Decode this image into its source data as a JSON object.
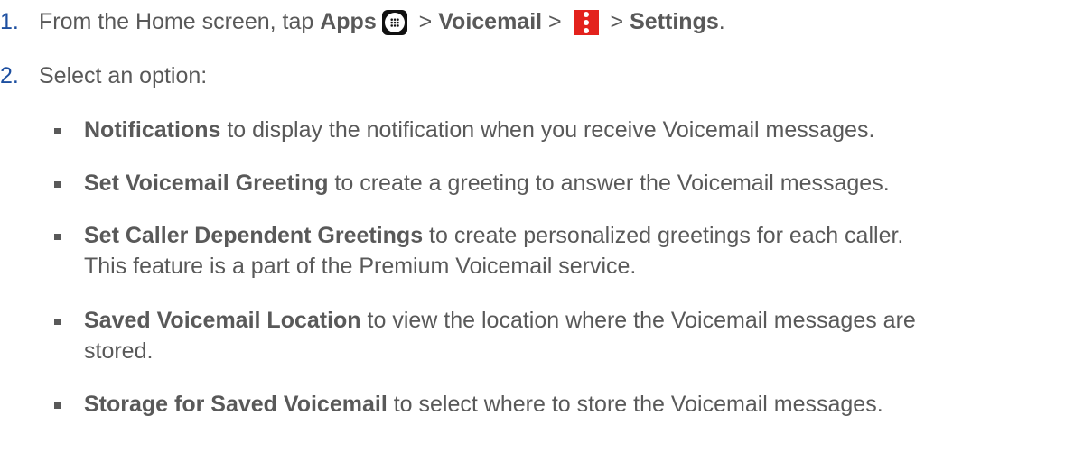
{
  "steps": [
    {
      "num": "1.",
      "pre": "From the Home screen, tap ",
      "apps": "Apps",
      "icon1": "apps-grid-icon",
      "sep1": " > ",
      "voicemail": "Voicemail",
      "sep2": " > ",
      "icon2": "menu-icon",
      "sep3": " > ",
      "settings": "Settings",
      "end": "."
    },
    {
      "num": "2.",
      "text": "Select an option:"
    }
  ],
  "options": [
    {
      "title": "Notifications",
      "desc": " to display the notification when you receive Voicemail messages."
    },
    {
      "title": "Set Voicemail Greeting",
      "desc": " to create a greeting to answer the Voicemail messages."
    },
    {
      "title": "Set Caller Dependent Greetings",
      "desc": " to create personalized greetings for each caller.",
      "desc2": "This feature is a part of the Premium Voicemail service."
    },
    {
      "title": "Saved Voicemail Location",
      "desc": " to view the location where the Voicemail messages are",
      "desc2": "stored."
    },
    {
      "title": "Storage for Saved Voicemail",
      "desc": " to select where to store the Voicemail messages."
    }
  ],
  "colors": {
    "number": "#1d4fa0",
    "text": "#595959",
    "menu_icon_bg": "#e3221d"
  }
}
